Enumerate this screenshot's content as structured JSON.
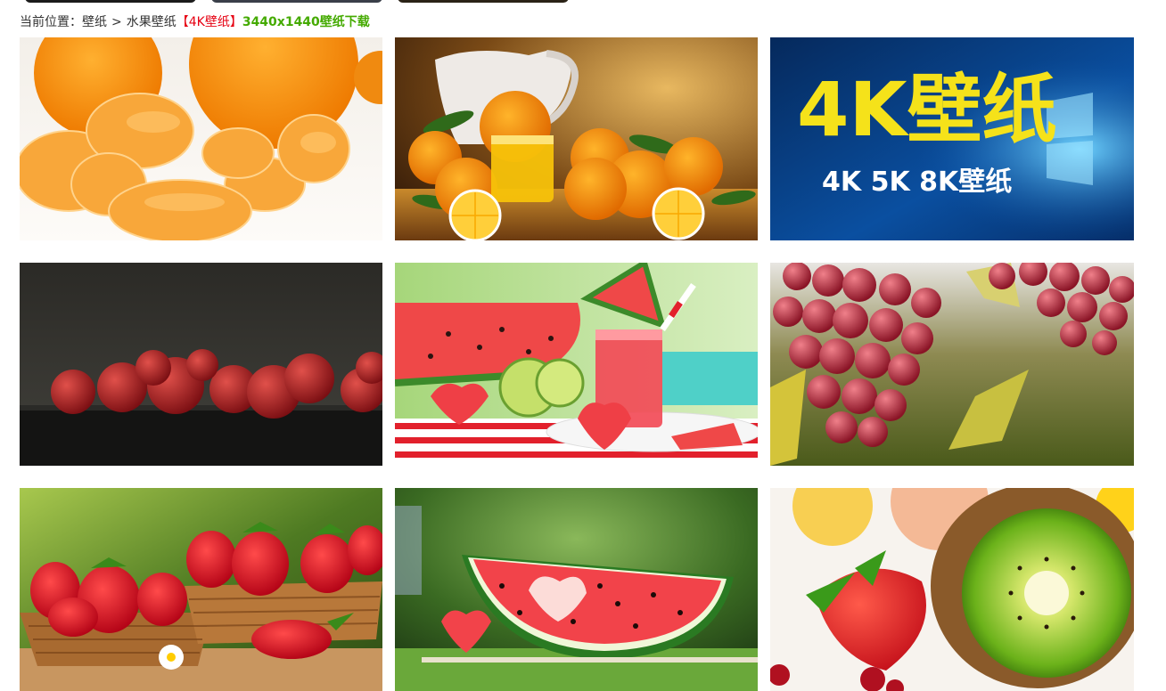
{
  "breadcrumb": {
    "prefix": "当前位置：",
    "home": "壁纸",
    "separator": ">",
    "category": "水果壁纸",
    "tag": "【4K壁纸】",
    "title": "3440x1440壁纸下载"
  },
  "wallpapers": [
    {
      "subject": "tangerine-segments",
      "alt": ""
    },
    {
      "subject": "orange-juice-pitcher",
      "alt": ""
    },
    {
      "subject": "4k-banner",
      "big_text": "4K壁纸",
      "sub_text": "4K 5K 8K壁纸"
    },
    {
      "subject": "red-apples",
      "alt": ""
    },
    {
      "subject": "watermelon-juice",
      "alt": ""
    },
    {
      "subject": "red-grapes",
      "alt": ""
    },
    {
      "subject": "strawberry-baskets",
      "alt": ""
    },
    {
      "subject": "watermelon-heart",
      "alt": ""
    },
    {
      "subject": "kiwi-strawberry",
      "alt": ""
    }
  ],
  "colors": {
    "breadcrumb_text": "#333333",
    "tag_red": "#e60012",
    "title_green": "#44aa00",
    "banner_blue": "#0a4fa0",
    "banner_yellow": "#f5e21a"
  }
}
